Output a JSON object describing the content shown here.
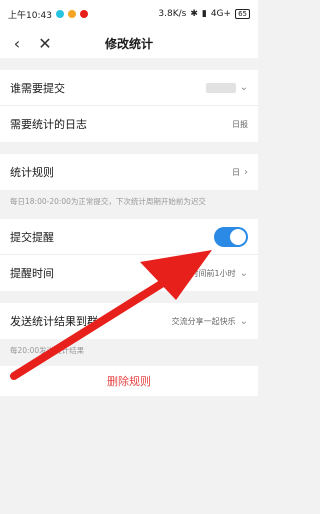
{
  "status_bar": {
    "time": "上午10:43",
    "speed": "3.8K/s",
    "network": "4G+",
    "battery": "65"
  },
  "nav": {
    "title": "修改统计"
  },
  "rows": {
    "submitter_label": "谁需要提交",
    "log_label": "需要统计的日志",
    "log_value": "日报",
    "rule_label": "统计规则",
    "rule_value": "日",
    "rule_note": "每日18:00-20:00为正常提交，下次统计周期开始前为迟交",
    "remind_label": "提交提醒",
    "remind_on": true,
    "remind_time_label": "提醒时间",
    "remind_time_value": "时间前1小时",
    "send_label": "发送统计结果到群",
    "send_value": "交流分享一起快乐",
    "send_note": "每20:00发送统计结果",
    "delete_label": "删除规则"
  },
  "colors": {
    "accent": "#2a8ae6",
    "danger": "#e64545",
    "arrow": "#e8201c"
  }
}
